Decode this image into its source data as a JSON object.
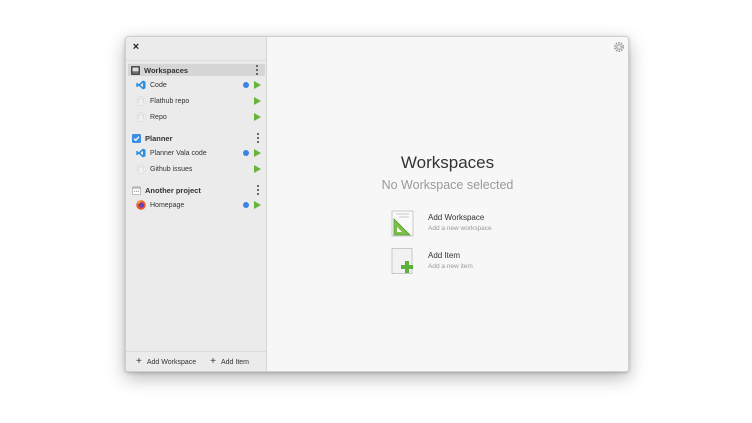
{
  "window": {
    "close_label": "×"
  },
  "sidebar": {
    "groups": [
      {
        "name": "Workspaces",
        "icon": "terminal-icon",
        "items": [
          {
            "name": "Code",
            "icon": "vscode-icon",
            "status_dot": true
          },
          {
            "name": "Flathub repo",
            "icon": "github-icon",
            "status_dot": false
          },
          {
            "name": "Repo",
            "icon": "github-icon",
            "status_dot": false
          }
        ]
      },
      {
        "name": "Planner",
        "icon": "checkbox-icon",
        "items": [
          {
            "name": "Planner Vala code",
            "icon": "vscode-icon",
            "status_dot": true
          },
          {
            "name": "Github issues",
            "icon": "github-icon",
            "status_dot": false
          }
        ]
      },
      {
        "name": "Another project",
        "icon": "calendar-icon",
        "items": [
          {
            "name": "Homepage",
            "icon": "firefox-icon",
            "status_dot": true
          }
        ]
      }
    ],
    "bottom": {
      "add_workspace": "Add Workspace",
      "add_item": "Add Item",
      "plus": "+"
    }
  },
  "main": {
    "title": "Workspaces",
    "subtitle": "No Workspace selected",
    "actions": [
      {
        "title": "Add Workspace",
        "subtitle": "Add a new workspace",
        "icon": "add-workspace-icon"
      },
      {
        "title": "Add Item",
        "subtitle": "Add a new item",
        "icon": "add-item-icon"
      }
    ]
  },
  "colors": {
    "accent_blue": "#3a82e6",
    "play_green": "#67b43c",
    "selected_row": "#d6d6d6"
  }
}
